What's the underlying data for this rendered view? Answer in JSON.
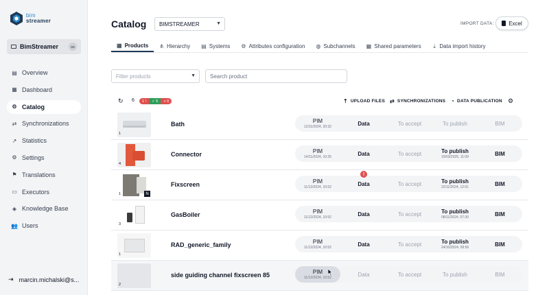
{
  "logo": {
    "line1": "bim",
    "line2": "streamer"
  },
  "workspace": {
    "name": "BimStreamer"
  },
  "nav": [
    {
      "label": "Overview",
      "icon": "overview-icon",
      "glyph": "▤"
    },
    {
      "label": "Dashboard",
      "icon": "dashboard-icon",
      "glyph": "▦"
    },
    {
      "label": "Catalog",
      "icon": "catalog-icon",
      "glyph": "⚙"
    },
    {
      "label": "Synchronizations",
      "icon": "sync-icon",
      "glyph": "⇄"
    },
    {
      "label": "Statistics",
      "icon": "statistics-icon",
      "glyph": "↗"
    },
    {
      "label": "Settings",
      "icon": "settings-icon",
      "glyph": "⚙"
    },
    {
      "label": "Translations",
      "icon": "flag-icon",
      "glyph": "⚑"
    },
    {
      "label": "Executors",
      "icon": "executors-icon",
      "glyph": "▭"
    },
    {
      "label": "Knowledge Base",
      "icon": "knowledge-icon",
      "glyph": "◈"
    },
    {
      "label": "Users",
      "icon": "users-icon",
      "glyph": "👥"
    }
  ],
  "active_nav": "Catalog",
  "user": {
    "email": "marcin.michalski@s..."
  },
  "header": {
    "title": "Catalog",
    "catalog_select": "BIMSTREAMER",
    "import_label": "IMPORT DATA:",
    "excel_button": "Excel"
  },
  "tabs": [
    {
      "label": "Products",
      "icon": "grid-icon",
      "glyph": "▦"
    },
    {
      "label": "Hierarchy",
      "icon": "hierarchy-icon",
      "glyph": "⋔"
    },
    {
      "label": "Systems",
      "icon": "systems-icon",
      "glyph": "▤"
    },
    {
      "label": "Attributes configuration",
      "icon": "gear-icon",
      "glyph": "⚙"
    },
    {
      "label": "Subchannels",
      "icon": "globe-icon",
      "glyph": "◍"
    },
    {
      "label": "Shared parameters",
      "icon": "table-icon",
      "glyph": "▦"
    },
    {
      "label": "Data import history",
      "icon": "import-icon",
      "glyph": "⇣"
    }
  ],
  "filters": {
    "filter_placeholder": "Filter products",
    "search_placeholder": "Search product"
  },
  "toolbar": {
    "count": "6",
    "badges": [
      {
        "text": "1 !",
        "color": "#e04f4f"
      },
      {
        "text": "✓ 5",
        "color": "#2e9e5b"
      },
      {
        "text": "+ 0",
        "color": "#e04f4f"
      }
    ],
    "upload": "UPLOAD FILES",
    "synchronizations": "SYNCHRONIZATIONS",
    "publication": "DATA PUBLICATION"
  },
  "stage_labels": {
    "pim": "PIM",
    "data": "Data",
    "accept": "To accept",
    "publish": "To publish",
    "bim": "BIM"
  },
  "products": [
    {
      "name": "Bath",
      "thumb_count": "1",
      "pim_date": "12/11/2024, 20:32",
      "publish_date": "",
      "publish_active": false,
      "bim_active": false,
      "warning": false
    },
    {
      "name": "Connector",
      "thumb_count": "4",
      "pim_date": "14/11/2024, 10:25",
      "publish_date": "19/03/2025, 11:09",
      "publish_active": true,
      "bim_active": true,
      "warning": false
    },
    {
      "name": "Fixscreen",
      "thumb_count": "1",
      "pim_date": "11/12/2024, 10:52",
      "publish_date": "22/11/2024, 12:01",
      "publish_active": true,
      "bim_active": true,
      "warning": true,
      "n_badge": "N"
    },
    {
      "name": "GasBoiler",
      "thumb_count": "3",
      "pim_date": "11/12/2024, 10:52",
      "publish_date": "08/11/2024, 07:30",
      "publish_active": true,
      "bim_active": true,
      "warning": false
    },
    {
      "name": "RAD_generic_family",
      "thumb_count": "1",
      "pim_date": "11/12/2024, 10:52",
      "publish_date": "24/10/2024, 09:56",
      "publish_active": true,
      "bim_active": true,
      "warning": false
    },
    {
      "name": "side guiding channel fixscreen 85",
      "thumb_count": "2",
      "pim_date": "11/12/2024, 10:52",
      "publish_date": "",
      "publish_active": false,
      "bim_active": false,
      "warning": false,
      "muted_data": true,
      "hovered": true
    }
  ],
  "colors": {
    "brand": "#1f3b57",
    "accent": "#2b8acb",
    "danger": "#e04f4f",
    "success": "#2e9e5b"
  }
}
